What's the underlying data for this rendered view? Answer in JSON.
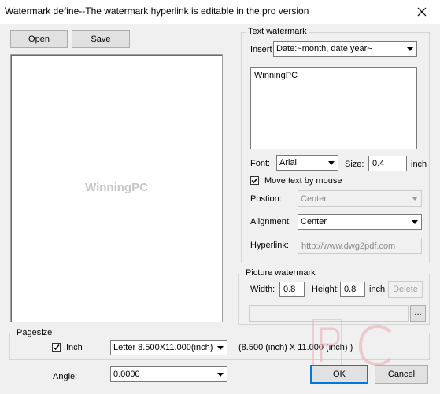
{
  "window": {
    "title": "Watermark define--The watermark hyperlink is editable in the pro version"
  },
  "toolbar": {
    "open_label": "Open",
    "save_label": "Save"
  },
  "preview": {
    "sample_text": "WinningPC"
  },
  "text_watermark": {
    "group_label": "Text watermark",
    "insert_label": "Insert",
    "insert_value": "Date:~month, date year~",
    "text_value": "WinningPC",
    "font_label": "Font:",
    "font_value": "Arial",
    "size_label": "Size:",
    "size_value": "0.4",
    "size_unit": "inch",
    "move_by_mouse_label": "Move text by mouse",
    "move_by_mouse_checked": true,
    "position_label": "Postion:",
    "position_value": "Center",
    "alignment_label": "Alignment:",
    "alignment_value": "Center",
    "hyperlink_label": "Hyperlink:",
    "hyperlink_value": "http://www.dwg2pdf.com"
  },
  "picture_watermark": {
    "group_label": "Picture watermark",
    "width_label": "Width:",
    "width_value": "0.8",
    "height_label": "Height:",
    "height_value": "0.8",
    "unit": "inch",
    "delete_label": "Delete",
    "path_value": "",
    "browse_label": "..."
  },
  "pagesize": {
    "group_label": "Pagesize",
    "inch_label": "Inch",
    "inch_checked": true,
    "size_value": "Letter  8.500X11.000(inch)",
    "dimensions_text": "(8.500 (inch) X 11.000 (inch) )"
  },
  "angle": {
    "label": "Angle:",
    "value": "0.0000"
  },
  "footer": {
    "ok_label": "OK",
    "cancel_label": "Cancel"
  },
  "colors": {
    "accent": "#0078d7",
    "watermark_red": "#d4828a"
  }
}
